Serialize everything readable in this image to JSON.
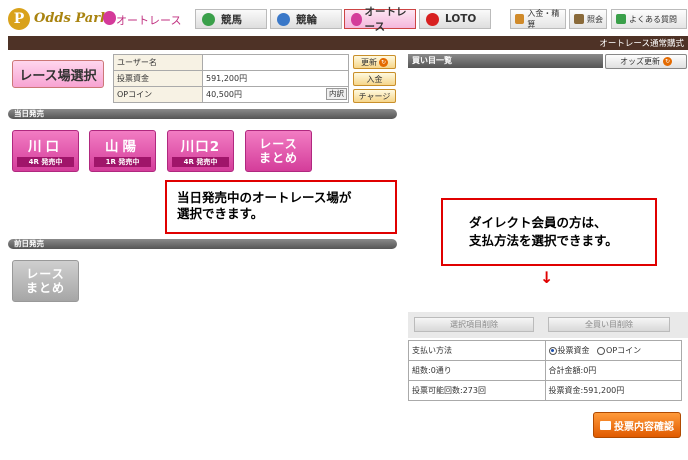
{
  "header": {
    "logo_mark": "P",
    "logo_text": "Odds Park",
    "logo_sub": "オートレース",
    "tabs": [
      {
        "label": "競馬"
      },
      {
        "label": "競輪"
      },
      {
        "label": "オートレース"
      },
      {
        "label": "LOTO"
      }
    ],
    "actions": [
      {
        "label": "入金・精算"
      },
      {
        "label": "照会"
      },
      {
        "label": "よくある質問"
      }
    ],
    "mode_label": "オートレース通常購式"
  },
  "venue_select": {
    "label": "レース場選択"
  },
  "user_info": {
    "username_label": "ユーザー名",
    "username_value": "",
    "balance_label": "投票資金",
    "balance_value": "591,200円",
    "op_label": "OPコイン",
    "op_value": "40,500円",
    "breakdown_label": "内訳",
    "buttons": {
      "refresh": "更新",
      "deposit": "入金",
      "charge": "チャージ"
    }
  },
  "today_section": {
    "title": "当日発売",
    "venues": [
      {
        "name": "川口",
        "status": "4R 発売中"
      },
      {
        "name": "山陽",
        "status": "1R 発売中"
      },
      {
        "name": "川口2",
        "status": "4R 発売中"
      }
    ],
    "summary_line1": "レース",
    "summary_line2": "まとめ"
  },
  "callout_left": {
    "line1": "当日発売中のオートレース場が",
    "line2": "選択できます。"
  },
  "prev_section": {
    "title": "前日発売",
    "summary_line1": "レース",
    "summary_line2": "まとめ"
  },
  "right_panel": {
    "title": "買い目一覧",
    "odds_refresh": "オッズ更新",
    "callout": {
      "line1": "ダイレクト会員の方は、",
      "line2": "支払方法を選択できます。"
    },
    "arrow": "↓",
    "delete_selected": "選択項目削除",
    "delete_all": "全買い目削除",
    "payment_label": "支払い方法",
    "payment_options": [
      "投票資金",
      "OPコイン"
    ],
    "count_label": "組数:0通り",
    "total_label": "合計金額:0円",
    "votes_label": "投票可能回数:273回",
    "funds_label": "投票資金:591,200円",
    "confirm": "投票内容確認"
  },
  "colors": {
    "brown_bar": "#4e3226",
    "pink_accent": "#d43d9a",
    "orange_accent": "#e05a00",
    "callout_red": "#e00000"
  }
}
